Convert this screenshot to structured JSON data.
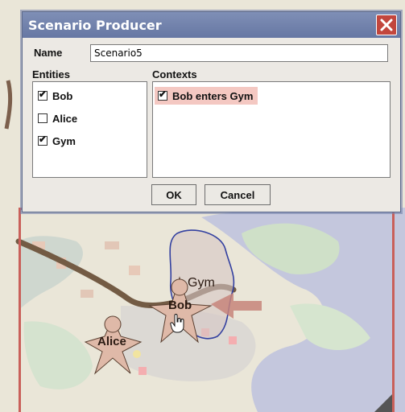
{
  "dialog": {
    "title": "Scenario Producer",
    "name_label": "Name",
    "name_value": "Scenario5",
    "entities_label": "Entities",
    "contexts_label": "Contexts",
    "entities": [
      {
        "label": "Bob",
        "checked": true
      },
      {
        "label": "Alice",
        "checked": false
      },
      {
        "label": "Gym",
        "checked": true
      }
    ],
    "contexts": [
      {
        "label": "Bob enters Gym",
        "checked": true
      }
    ],
    "ok_label": "OK",
    "cancel_label": "Cancel"
  },
  "map": {
    "labels": {
      "gym": "Gym",
      "bob": "Bob",
      "alice": "Alice"
    }
  },
  "colors": {
    "title_bar": "#6f7fab",
    "close_button": "#c2463d",
    "selected_context": "#f4c8c2",
    "map_frame": "#c9605a",
    "gym_outline": "#3340a0",
    "entity_fill": "#dfb9a8"
  },
  "icons": [
    "close-icon",
    "hand-pointer-icon",
    "person-star-icon"
  ]
}
